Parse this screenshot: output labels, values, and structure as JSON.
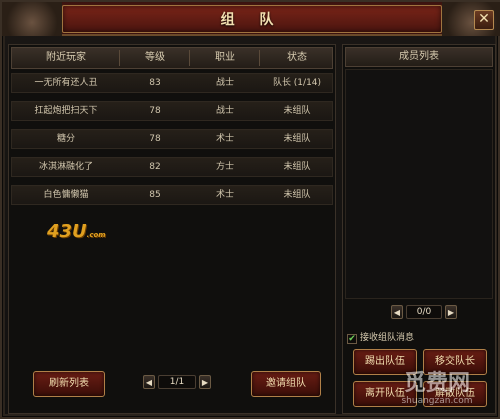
{
  "window": {
    "title": "组 队",
    "close_label": "✕"
  },
  "table": {
    "headers": [
      "附近玩家",
      "等级",
      "职业",
      "状态"
    ],
    "rows": [
      {
        "name": "一无所有还人丑",
        "level": "83",
        "class": "战士",
        "status": "队长 (1/14)"
      },
      {
        "name": "扛起炮把扫天下",
        "level": "78",
        "class": "战士",
        "status": "未组队"
      },
      {
        "name": "糖分",
        "level": "78",
        "class": "术士",
        "status": "未组队"
      },
      {
        "name": "冰淇淋融化了",
        "level": "82",
        "class": "方士",
        "status": "未组队"
      },
      {
        "name": "白色慵懒猫",
        "level": "85",
        "class": "术士",
        "status": "未组队"
      }
    ]
  },
  "watermark": {
    "main": "43U",
    "suffix": ".com"
  },
  "footer": {
    "refresh_label": "刷新列表",
    "invite_label": "邀请组队",
    "pager": {
      "prev": "◀",
      "next": "▶",
      "value": "1/1"
    }
  },
  "members": {
    "header": "成员列表",
    "pager": {
      "prev": "◀",
      "next": "▶",
      "value": "0/0"
    },
    "receive_checkbox": {
      "label": "接收组队消息",
      "checked": true,
      "mark": "✔"
    },
    "buttons": {
      "kick": "踢出队伍",
      "transfer": "移交队长",
      "leave": "离开队伍",
      "disband": "解散队伍"
    }
  },
  "site_watermark": {
    "brand": "觅费网",
    "url": "shuangzan.com"
  },
  "colors": {
    "title_bar": "#5a1c15",
    "button_red": "#6a1d14",
    "gold_border": "#b08048",
    "text": "#d9cfb9",
    "checkbox_green": "#6fd05a"
  }
}
